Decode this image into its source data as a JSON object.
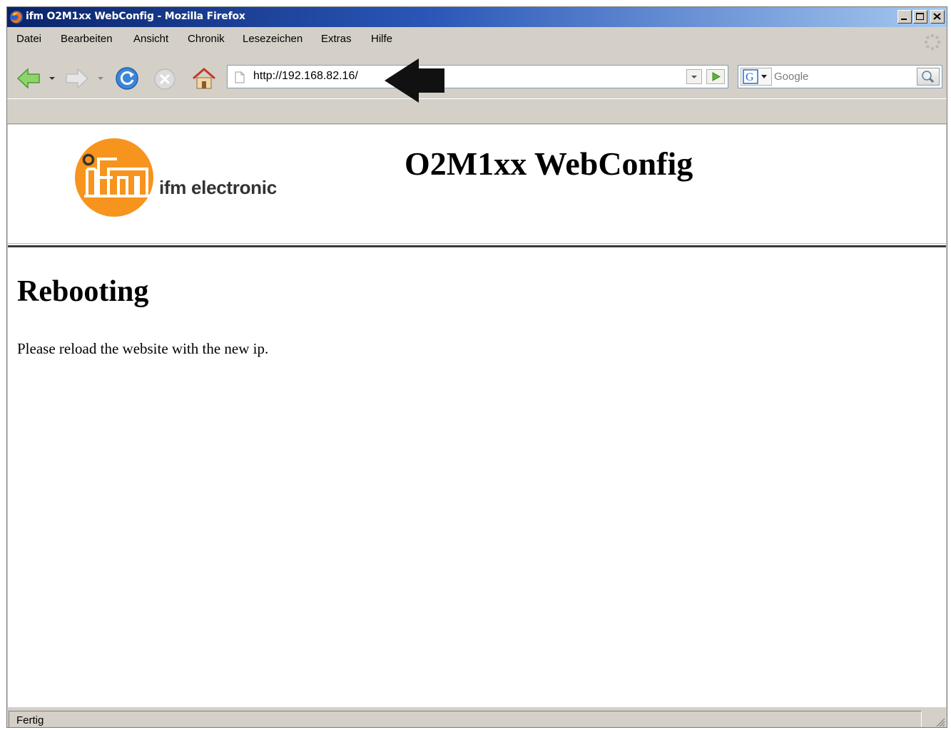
{
  "window": {
    "title": "ifm O2M1xx WebConfig - Mozilla Firefox"
  },
  "menu": [
    {
      "label": "Datei"
    },
    {
      "label": "Bearbeiten"
    },
    {
      "label": "Ansicht"
    },
    {
      "label": "Chronik"
    },
    {
      "label": "Lesezeichen"
    },
    {
      "label": "Extras"
    },
    {
      "label": "Hilfe"
    }
  ],
  "address": {
    "url": "http://192.168.82.16/"
  },
  "search": {
    "placeholder": "Google"
  },
  "header": {
    "logo_text": "ifm electronic",
    "site_title": "O2M1xx WebConfig"
  },
  "main": {
    "heading": "Rebooting",
    "message": "Please reload the website with the new ip."
  },
  "status": {
    "text": "Fertig"
  },
  "colors": {
    "logo_orange": "#f7941d",
    "titlebar": "#0a246a"
  }
}
